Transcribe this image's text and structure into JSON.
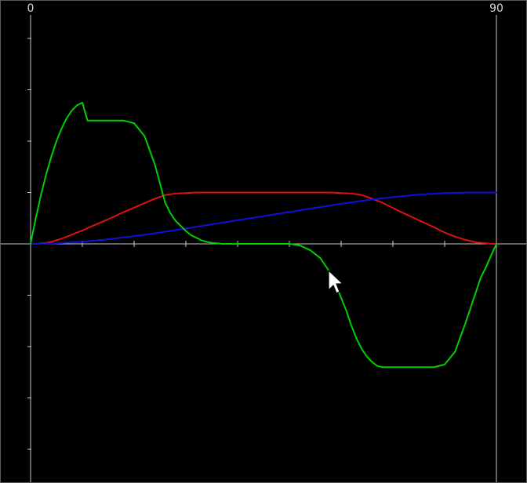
{
  "chart_data": {
    "type": "line",
    "xlim": [
      0,
      90
    ],
    "ylim": [
      -4.6,
      4.6
    ],
    "x_tick_labels": [
      "0",
      "90"
    ],
    "x_ticks": [
      0,
      10,
      20,
      30,
      40,
      50,
      60,
      70,
      80,
      90
    ],
    "y_ticks": [
      -4,
      -3,
      -2,
      -1,
      1,
      2,
      3,
      4
    ],
    "grid": false,
    "background": "#000000",
    "axis_color": "#c8c8c8",
    "series": [
      {
        "color": "#00d000",
        "x": [
          0,
          0.5,
          1,
          2,
          3,
          4,
          5,
          6,
          7,
          8,
          9,
          10,
          11,
          14,
          18,
          20,
          22,
          24,
          26,
          27,
          28,
          29,
          30,
          31,
          32,
          33,
          34,
          35,
          36,
          37,
          38,
          39,
          40,
          45,
          50,
          52,
          54,
          56,
          58,
          59,
          60,
          61,
          62,
          63,
          64,
          65,
          66,
          67,
          68,
          69,
          70,
          71,
          74,
          78,
          80,
          82,
          84,
          86,
          87,
          88,
          89,
          89.5,
          90
        ],
        "y": [
          0,
          0.25,
          0.5,
          0.95,
          1.35,
          1.7,
          2.0,
          2.25,
          2.45,
          2.6,
          2.7,
          2.75,
          2.4,
          2.4,
          2.4,
          2.35,
          2.1,
          1.55,
          0.8,
          0.6,
          0.45,
          0.35,
          0.25,
          0.17,
          0.12,
          0.07,
          0.04,
          0.02,
          0.01,
          0,
          0,
          0,
          0,
          0,
          0,
          -0.03,
          -0.12,
          -0.28,
          -0.58,
          -0.8,
          -1.05,
          -1.3,
          -1.6,
          -1.85,
          -2.05,
          -2.2,
          -2.3,
          -2.38,
          -2.4,
          -2.4,
          -2.4,
          -2.4,
          -2.4,
          -2.4,
          -2.35,
          -2.1,
          -1.55,
          -0.95,
          -0.65,
          -0.45,
          -0.22,
          -0.11,
          0
        ]
      },
      {
        "color": "#e01010",
        "x": [
          0,
          1,
          2,
          3,
          4,
          5,
          6,
          7,
          8,
          9,
          10,
          12,
          15,
          18,
          21,
          24,
          26,
          28,
          30,
          32,
          35,
          40,
          50,
          55,
          58,
          60,
          62,
          64,
          66,
          68,
          70,
          72,
          75,
          78,
          80,
          82,
          84,
          86,
          87,
          88,
          89,
          90
        ],
        "y": [
          0,
          0,
          0.01,
          0.02,
          0.04,
          0.07,
          0.1,
          0.14,
          0.18,
          0.22,
          0.26,
          0.35,
          0.48,
          0.62,
          0.75,
          0.88,
          0.95,
          0.98,
          0.99,
          1.0,
          1.0,
          1.0,
          1.0,
          1.0,
          1.0,
          0.99,
          0.98,
          0.95,
          0.88,
          0.8,
          0.7,
          0.6,
          0.46,
          0.32,
          0.22,
          0.14,
          0.08,
          0.03,
          0.02,
          0.01,
          0,
          0
        ]
      },
      {
        "color": "#1010d8",
        "x": [
          0,
          5,
          10,
          15,
          20,
          25,
          30,
          35,
          40,
          45,
          50,
          55,
          60,
          65,
          70,
          75,
          80,
          85,
          90
        ],
        "y": [
          0,
          0.01,
          0.04,
          0.09,
          0.15,
          0.22,
          0.3,
          0.38,
          0.46,
          0.54,
          0.62,
          0.7,
          0.78,
          0.85,
          0.91,
          0.96,
          0.99,
          1.0,
          1.0
        ]
      }
    ]
  },
  "cursor": {
    "icon": "arrow-cursor-icon",
    "fill": "#ffffff",
    "stroke": "#000000"
  }
}
